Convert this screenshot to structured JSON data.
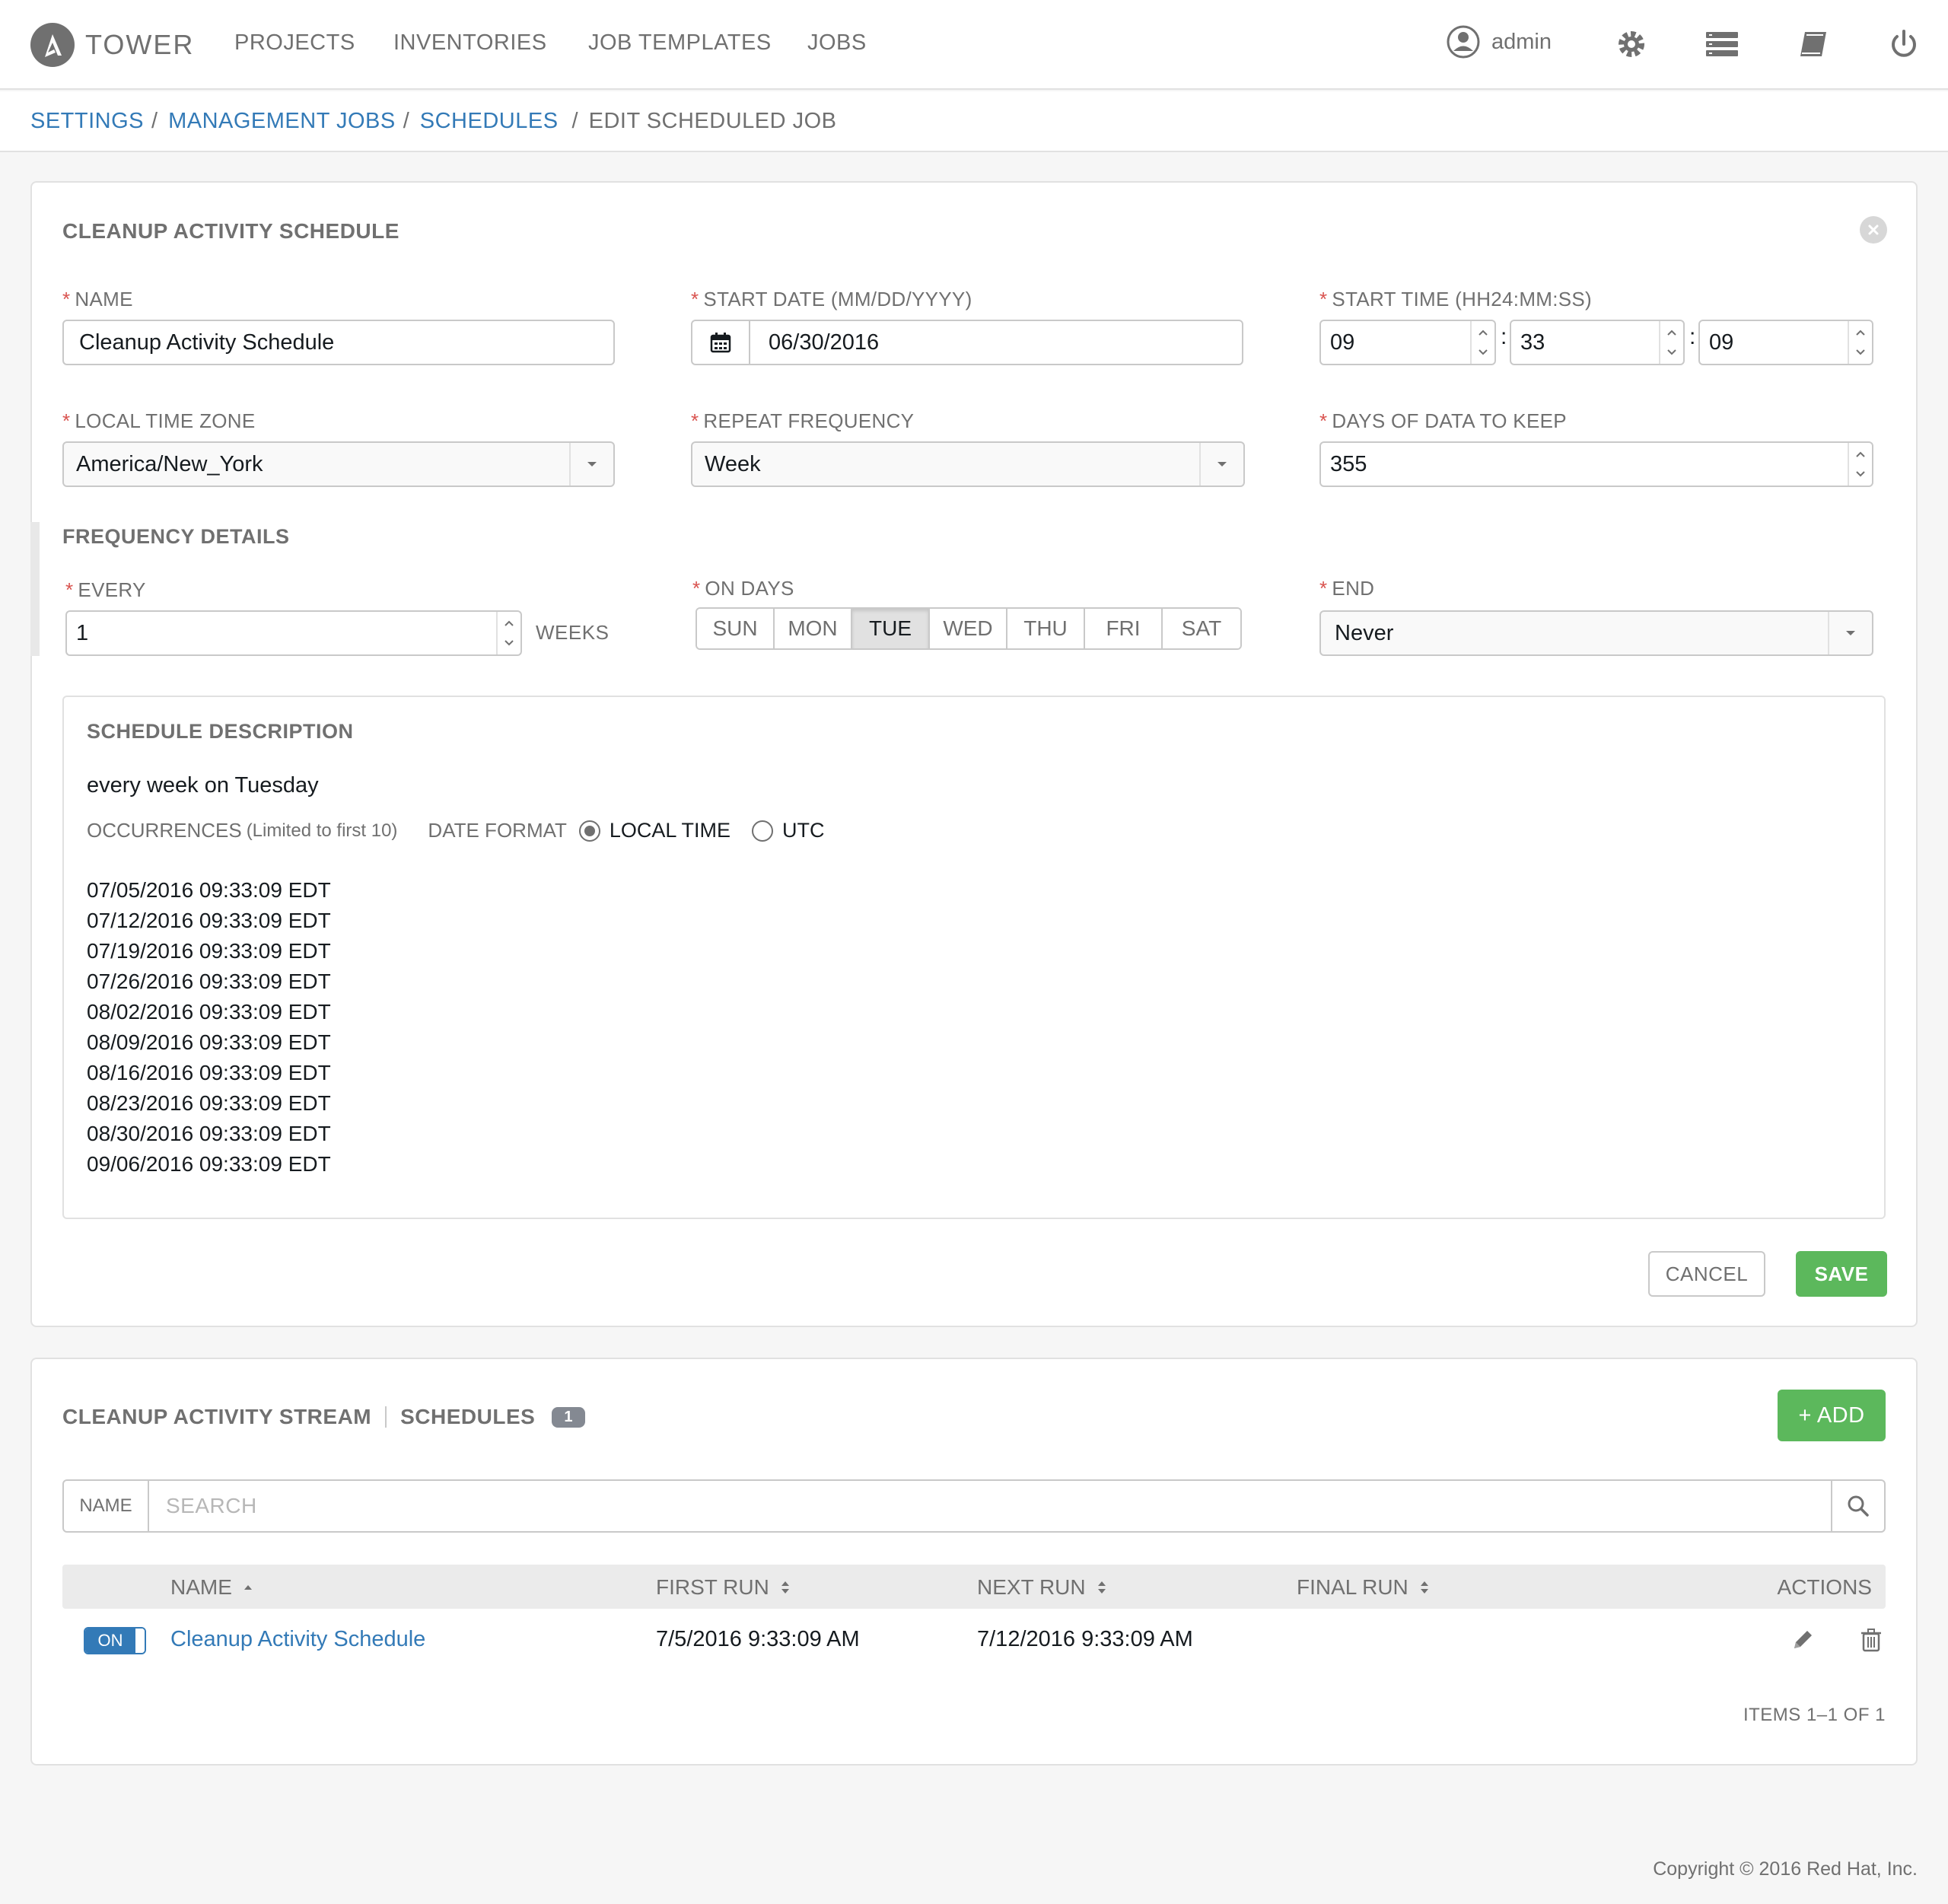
{
  "app": {
    "logo_letter": "A",
    "logo_text": "TOWER"
  },
  "nav": {
    "links": [
      "PROJECTS",
      "INVENTORIES",
      "JOB TEMPLATES",
      "JOBS"
    ],
    "user": "admin",
    "icons": [
      "user-icon",
      "gear-icon",
      "list-icon",
      "book-icon",
      "power-icon"
    ]
  },
  "breadcrumb": {
    "items": [
      "SETTINGS",
      "MANAGEMENT JOBS",
      "SCHEDULES"
    ],
    "separator": "/",
    "current": "EDIT SCHEDULED JOB"
  },
  "form": {
    "title": "CLEANUP ACTIVITY SCHEDULE",
    "required_mark": "*",
    "name": {
      "label": "NAME",
      "value": "Cleanup Activity Schedule"
    },
    "start_date": {
      "label": "START DATE (MM/DD/YYYY)",
      "value": "06/30/2016"
    },
    "start_time": {
      "label": "START TIME (HH24:MM:SS)",
      "hours": "09",
      "minutes": "33",
      "seconds": "09",
      "separator": ":"
    },
    "timezone": {
      "label": "LOCAL TIME ZONE",
      "value": "America/New_York"
    },
    "repeat": {
      "label": "REPEAT FREQUENCY",
      "value": "Week"
    },
    "days_keep": {
      "label": "DAYS OF DATA TO KEEP",
      "value": "355"
    },
    "frequency_heading": "FREQUENCY DETAILS",
    "every": {
      "label": "EVERY",
      "value": "1",
      "unit": "WEEKS"
    },
    "on_days": {
      "label": "ON DAYS",
      "days": [
        "SUN",
        "MON",
        "TUE",
        "WED",
        "THU",
        "FRI",
        "SAT"
      ],
      "selected": "TUE"
    },
    "end": {
      "label": "END",
      "value": "Never"
    },
    "description": {
      "title": "SCHEDULE DESCRIPTION",
      "text": "every week on Tuesday",
      "occurrences_label": "OCCURRENCES",
      "occurrences_note": "(Limited to first 10)",
      "date_format_label": "DATE FORMAT",
      "options": [
        "LOCAL TIME",
        "UTC"
      ],
      "selected_option": "LOCAL TIME",
      "occurrences": [
        "07/05/2016 09:33:09 EDT",
        "07/12/2016 09:33:09 EDT",
        "07/19/2016 09:33:09 EDT",
        "07/26/2016 09:33:09 EDT",
        "08/02/2016 09:33:09 EDT",
        "08/09/2016 09:33:09 EDT",
        "08/16/2016 09:33:09 EDT",
        "08/23/2016 09:33:09 EDT",
        "08/30/2016 09:33:09 EDT",
        "09/06/2016 09:33:09 EDT"
      ]
    },
    "cancel_label": "CANCEL",
    "save_label": "SAVE"
  },
  "list": {
    "title": "CLEANUP ACTIVITY STREAM",
    "subtitle": "SCHEDULES",
    "count": "1",
    "add_label": "+ ADD",
    "search": {
      "key": "NAME",
      "placeholder": "SEARCH"
    },
    "columns": [
      "NAME",
      "FIRST RUN",
      "NEXT RUN",
      "FINAL RUN",
      "ACTIONS"
    ],
    "rows": [
      {
        "toggle": "ON",
        "name": "Cleanup Activity Schedule",
        "first_run": "7/5/2016 9:33:09 AM",
        "next_run": "7/12/2016 9:33:09 AM",
        "final_run": ""
      }
    ],
    "items_label": "ITEMS 1–1 OF 1"
  },
  "footer": {
    "copyright": "Copyright © 2016 Red Hat, Inc."
  },
  "colors": {
    "accent": "#337ab7",
    "success": "#5cb85c",
    "muted": "#707070",
    "required": "#d9534f"
  }
}
